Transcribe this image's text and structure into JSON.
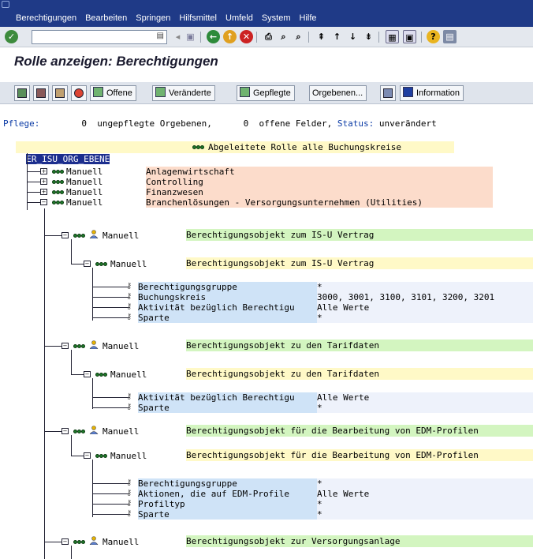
{
  "menu": {
    "items": [
      "Berechtigungen",
      "Bearbeiten",
      "Springen",
      "Hilfsmittel",
      "Umfeld",
      "System",
      "Hilfe"
    ]
  },
  "toolbar": {
    "command_value": ""
  },
  "title": "Rolle anzeigen: Berechtigungen",
  "app_toolbar": {
    "offene": "Offene",
    "veraenderte": "Veränderte",
    "gepflegte": "Gepflegte",
    "orgebenen": "Orgebenen...",
    "information": "Information"
  },
  "status": {
    "label": "Pflege:",
    "text1": "   0  ungepflegte Orgebenen,      0  offene Felder,",
    "status_label": "Status:",
    "status_value": "unverändert"
  },
  "root": {
    "name": "ER_ISU_ORG_EBENE",
    "desc": "Abgeleitete Rolle alle Buchungskreise"
  },
  "level1": [
    {
      "type": "Manuell",
      "desc": "Anlagenwirtschaft"
    },
    {
      "type": "Manuell",
      "desc": "Controlling"
    },
    {
      "type": "Manuell",
      "desc": "Finanzwesen"
    },
    {
      "type": "Manuell",
      "desc": "Branchenlösungen - Versorgungsunternehmen (Utilities)"
    }
  ],
  "objects": [
    {
      "type": "Manuell",
      "desc": "Berechtigungsobjekt zum IS-U Vertrag",
      "sub_type": "Manuell",
      "sub_desc": "Berechtigungsobjekt zum IS-U Vertrag",
      "fields": [
        {
          "name": "Berechtigungsgruppe",
          "value": "*"
        },
        {
          "name": "Buchungskreis",
          "value": "3000, 3001, 3100, 3101, 3200, 3201"
        },
        {
          "name": "Aktivität bezüglich Berechtigu",
          "value": "Alle Werte"
        },
        {
          "name": "Sparte",
          "value": "*"
        }
      ]
    },
    {
      "type": "Manuell",
      "desc": "Berechtigungsobjekt zu den Tarifdaten",
      "sub_type": "Manuell",
      "sub_desc": "Berechtigungsobjekt zu den Tarifdaten",
      "fields": [
        {
          "name": "Aktivität bezüglich Berechtigu",
          "value": "Alle Werte"
        },
        {
          "name": "Sparte",
          "value": "*"
        }
      ]
    },
    {
      "type": "Manuell",
      "desc": "Berechtigungsobjekt für die Bearbeitung von EDM-Profilen",
      "sub_type": "Manuell",
      "sub_desc": "Berechtigungsobjekt für die Bearbeitung von EDM-Profilen",
      "fields": [
        {
          "name": "Berechtigungsgruppe",
          "value": "*"
        },
        {
          "name": "Aktionen, die auf EDM-Profile",
          "value": "Alle Werte"
        },
        {
          "name": "Profiltyp",
          "value": "*"
        },
        {
          "name": "Sparte",
          "value": "*"
        }
      ]
    },
    {
      "type": "Manuell",
      "desc": "Berechtigungsobjekt zur Versorgungsanlage"
    }
  ]
}
